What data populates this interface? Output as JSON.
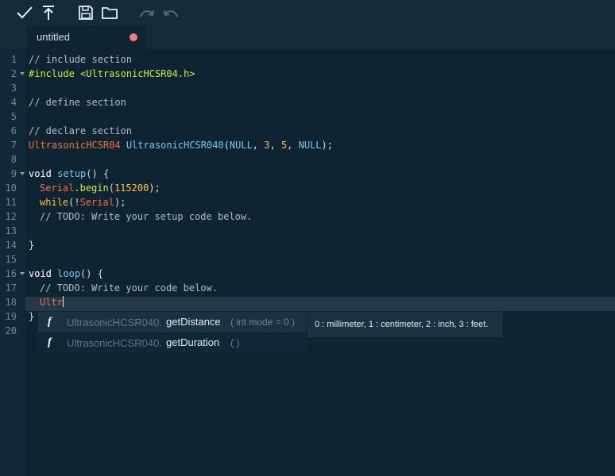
{
  "toolbar": {
    "buttons": [
      {
        "id": "verify",
        "icon": "check-icon"
      },
      {
        "id": "upload",
        "icon": "upload-icon"
      },
      {
        "id": "save",
        "icon": "save-icon"
      },
      {
        "id": "open",
        "icon": "folder-icon"
      },
      {
        "id": "redo",
        "icon": "redo-icon"
      },
      {
        "id": "undo",
        "icon": "undo-icon"
      }
    ]
  },
  "tab": {
    "label": "untitled",
    "modified_indicator_color": "#ef7b7b"
  },
  "editor": {
    "line_numbers": [
      "1",
      "2",
      "3",
      "4",
      "5",
      "6",
      "7",
      "8",
      "9",
      "10",
      "11",
      "12",
      "13",
      "14",
      "15",
      "16",
      "17",
      "18",
      "19",
      "20"
    ],
    "lines": {
      "l1": "// include section",
      "l2": "#include <UltrasonicHCSR04.h>",
      "l4": "// define section",
      "l6": "// declare section",
      "l7_class": "UltrasonicHCSR04",
      "l7_obj": "UltrasonicHCSR040",
      "l7_open": "(",
      "l7_null1": "NULL",
      "l7_c1": ", ",
      "l7_n3": "3",
      "l7_c2": ", ",
      "l7_n5": "5",
      "l7_c3": ", ",
      "l7_null2": "NULL",
      "l7_close": ");",
      "l9_kw": "void",
      "l9_fn": "setup",
      "l9_rest": "() {",
      "l10_obj": "Serial",
      "l10_dot": ".",
      "l10_fn": "begin",
      "l10_open": "(",
      "l10_num": "115200",
      "l10_close": ");",
      "l11_kw": "while",
      "l11_open": "(!",
      "l11_obj": "Serial",
      "l11_close": ");",
      "l12": "// TODO: Write your setup code below.",
      "l14": "}",
      "l16_kw": "void",
      "l16_fn": "loop",
      "l16_rest": "() {",
      "l17": "// TODO: Write your code below.",
      "l18": "Ultr",
      "l19": "}"
    }
  },
  "autocomplete": {
    "items": [
      {
        "kind": "f",
        "object": "UltrasonicHCSR040.",
        "method": "getDistance",
        "args": "( int mode = 0 )"
      },
      {
        "kind": "f",
        "object": "UltrasonicHCSR040.",
        "method": "getDuration",
        "args": "( )"
      }
    ],
    "hint": "0 : millimeter, 1 : centimeter, 2 : inch, 3 : feet."
  }
}
